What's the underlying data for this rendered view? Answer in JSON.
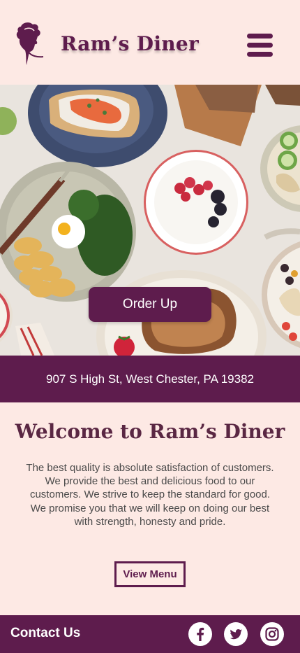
{
  "header": {
    "brand": "Ram’s Diner",
    "logo_icon": "chef-head-icon",
    "menu_icon": "hamburger-menu-icon"
  },
  "hero": {
    "image": "breakfast-table-photo",
    "order_button": "Order Up"
  },
  "location": {
    "address": "907 S High St, West Chester, PA 19382"
  },
  "welcome": {
    "title": "Welcome to Ram’s Diner",
    "body": "The best quality is absolute satisfaction of customers. We provide the best and delicious food to our customers. We strive to keep the standard for good. We promise you that we will keep on doing our best with strength, honesty and pride.",
    "button": "View Menu"
  },
  "footer": {
    "contact": "Contact Us",
    "social": [
      "facebook-icon",
      "twitter-icon",
      "instagram-icon"
    ]
  },
  "colors": {
    "brand": "#5e1c4d",
    "background": "#fde9e4",
    "white": "#ffffff"
  }
}
